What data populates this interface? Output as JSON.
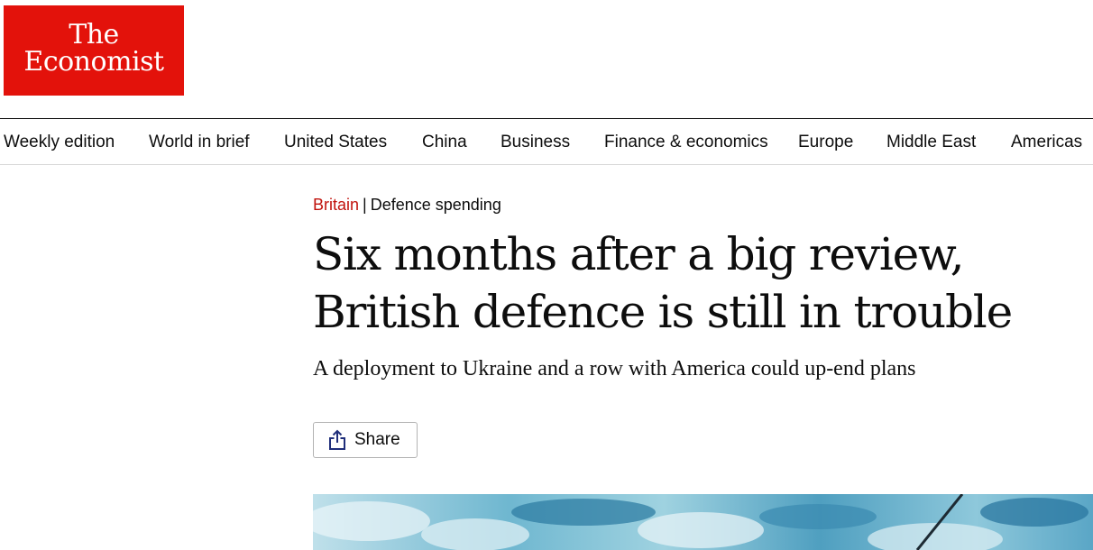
{
  "logo": {
    "line1": "The",
    "line2": "Economist"
  },
  "nav": {
    "items": [
      "Weekly edition",
      "World in brief",
      "United States",
      "China",
      "Business",
      "Finance & economics",
      "Europe",
      "Middle East",
      "Americas"
    ]
  },
  "article": {
    "section": "Britain",
    "separator": "|",
    "flytitle": "Defence spending",
    "headline_line1": "Six months after a big review,",
    "headline_line2": "British defence is still in trouble",
    "subheadline": "A deployment to Ukraine and a row with America could up-end plans",
    "share_label": "Share",
    "share_icon": "share-icon"
  },
  "colors": {
    "brand_red": "#e3120b",
    "section_red": "#c1130d",
    "share_icon_blue": "#1f2e7a"
  }
}
